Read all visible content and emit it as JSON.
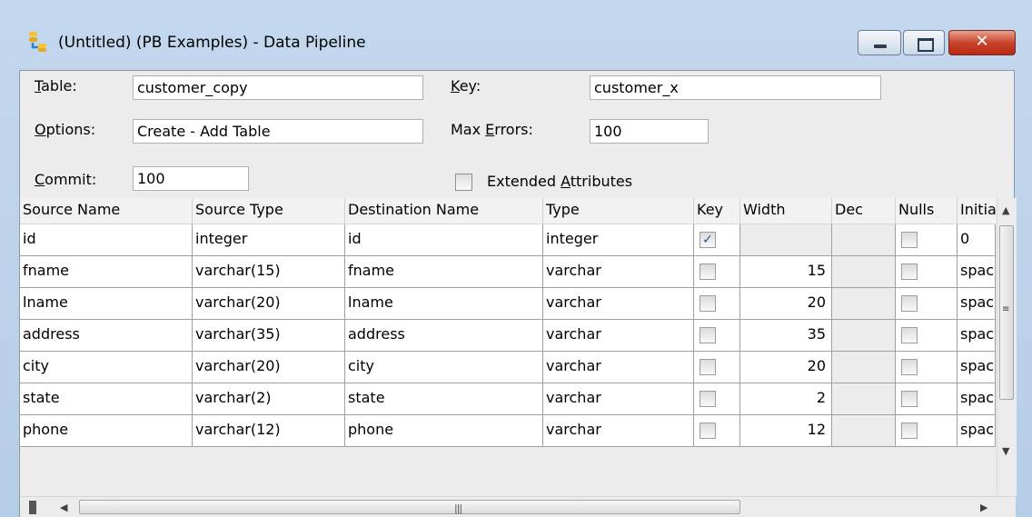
{
  "window": {
    "title": "(Untitled) (PB Examples) - Data Pipeline",
    "close_glyph": "✕"
  },
  "form": {
    "table_label_letter": "T",
    "table_label_rest": "able:",
    "table_value": "customer_copy",
    "key_label_letter": "K",
    "key_label_rest": "ey:",
    "key_value": "customer_x",
    "options_label_letter": "O",
    "options_label_rest": "ptions:",
    "options_value": "Create - Add Table",
    "max_errors_label_pre": "Max ",
    "max_errors_label_letter": "E",
    "max_errors_label_rest": "rrors:",
    "max_errors_value": "100",
    "commit_label_letter": "C",
    "commit_label_rest": "ommit:",
    "commit_value": "100",
    "extended_label_pre": "Extended ",
    "extended_label_letter": "A",
    "extended_label_rest": "ttributes",
    "extended_checked": false
  },
  "grid": {
    "columns": [
      "Source Name",
      "Source Type",
      "Destination Name",
      "Type",
      "Key",
      "Width",
      "Dec",
      "Nulls",
      "Initia"
    ],
    "rows": [
      {
        "source_name": "id",
        "source_type": "integer",
        "dest_name": "id",
        "type": "integer",
        "key": true,
        "width": "",
        "dec": "",
        "nulls": false,
        "initial": "0"
      },
      {
        "source_name": "fname",
        "source_type": "varchar(15)",
        "dest_name": "fname",
        "type": "varchar",
        "key": false,
        "width": "15",
        "dec": "",
        "nulls": false,
        "initial": "spac"
      },
      {
        "source_name": "lname",
        "source_type": "varchar(20)",
        "dest_name": "lname",
        "type": "varchar",
        "key": false,
        "width": "20",
        "dec": "",
        "nulls": false,
        "initial": "spac"
      },
      {
        "source_name": "address",
        "source_type": "varchar(35)",
        "dest_name": "address",
        "type": "varchar",
        "key": false,
        "width": "35",
        "dec": "",
        "nulls": false,
        "initial": "spac"
      },
      {
        "source_name": "city",
        "source_type": "varchar(20)",
        "dest_name": "city",
        "type": "varchar",
        "key": false,
        "width": "20",
        "dec": "",
        "nulls": false,
        "initial": "spac"
      },
      {
        "source_name": "state",
        "source_type": "varchar(2)",
        "dest_name": "state",
        "type": "varchar",
        "key": false,
        "width": "2",
        "dec": "",
        "nulls": false,
        "initial": "spac"
      },
      {
        "source_name": "phone",
        "source_type": "varchar(12)",
        "dest_name": "phone",
        "type": "varchar",
        "key": false,
        "width": "12",
        "dec": "",
        "nulls": false,
        "initial": "spac"
      }
    ],
    "check_glyph": "✓"
  },
  "scrollbars": {
    "up_arrow": "▲",
    "down_arrow": "▼",
    "left_arrow": "◀",
    "right_arrow": "▶",
    "grip": "|||"
  }
}
